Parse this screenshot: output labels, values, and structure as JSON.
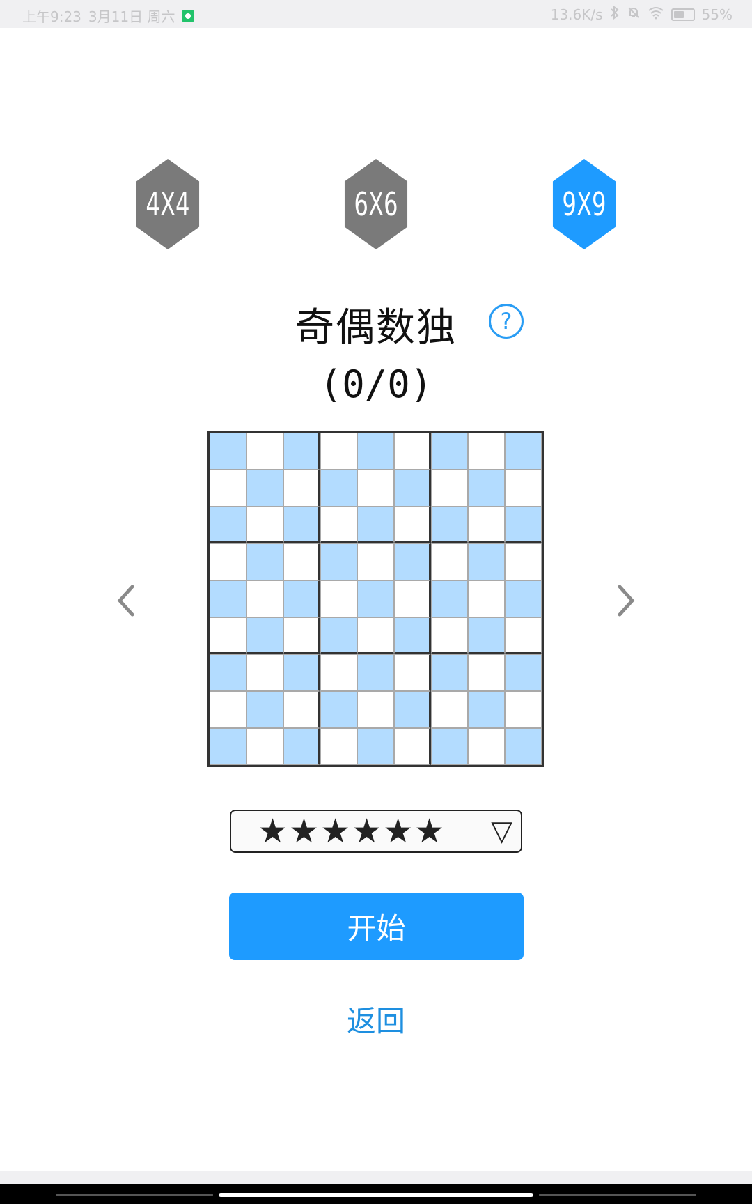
{
  "status_bar": {
    "time": "上午9:23",
    "date": "3月11日 周六",
    "speed": "13.6K/s",
    "battery": "55%",
    "battery_level": 0.55
  },
  "size_options": [
    {
      "label": "4X4",
      "selected": false
    },
    {
      "label": "6X6",
      "selected": false
    },
    {
      "label": "9X9",
      "selected": true
    }
  ],
  "puzzle": {
    "title": "奇偶数独",
    "help_symbol": "?",
    "progress": "(0/0)"
  },
  "difficulty": {
    "stars": "★★★★★★",
    "rating": 6,
    "dropdown_symbol": "▽"
  },
  "actions": {
    "start_label": "开始",
    "back_label": "返回"
  },
  "colors": {
    "accent": "#1e9bff",
    "hex_inactive": "#7a7a7a",
    "shaded_cell": "#b3dcff"
  }
}
